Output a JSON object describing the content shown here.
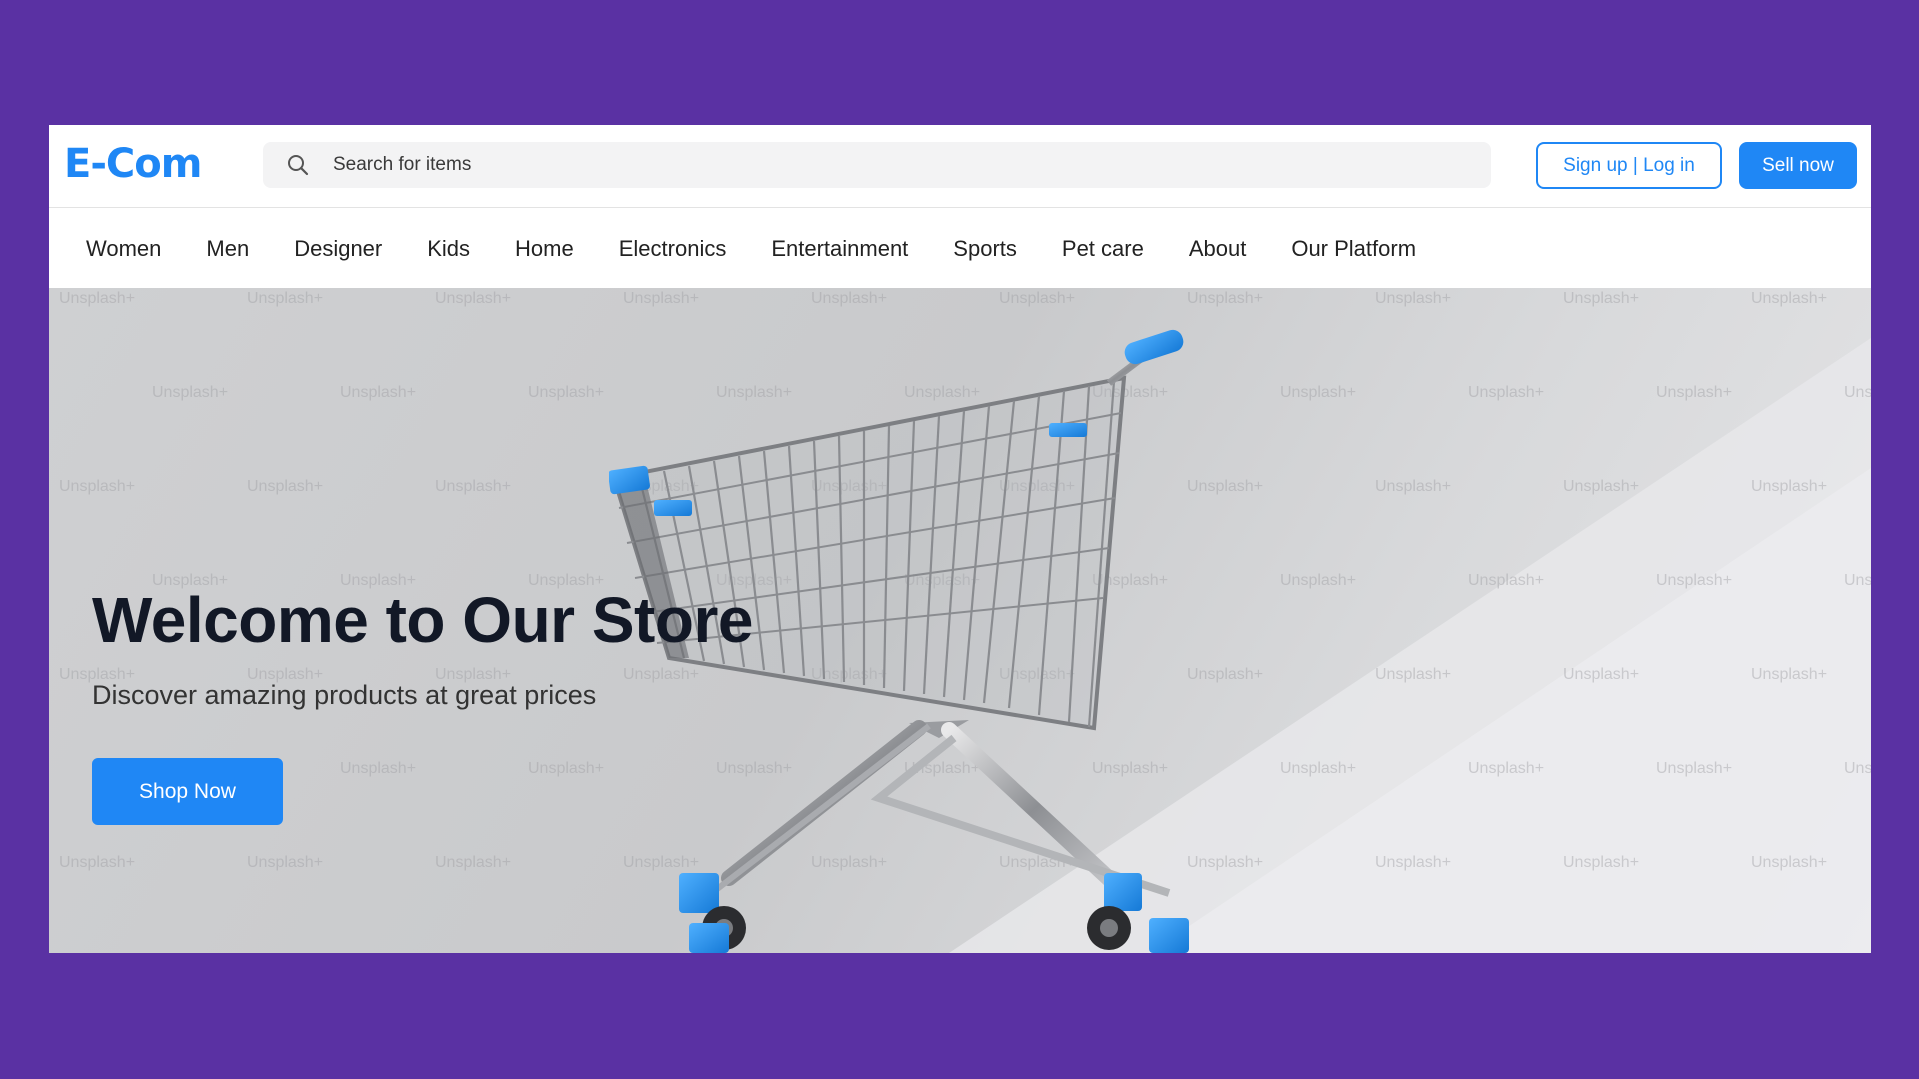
{
  "header": {
    "logo": "E-Com",
    "search": {
      "placeholder": "Search for items",
      "icon": "search-icon"
    },
    "auth_label": "Sign up | Log in",
    "sell_label": "Sell now"
  },
  "nav": {
    "items": [
      "Women",
      "Men",
      "Designer",
      "Kids",
      "Home",
      "Electronics",
      "Entertainment",
      "Sports",
      "Pet care",
      "About",
      "Our Platform"
    ]
  },
  "hero": {
    "title": "Welcome to Our Store",
    "subtitle": "Discover amazing products at great prices",
    "cta_label": "Shop Now",
    "watermark_text": "Unsplash+"
  },
  "colors": {
    "background": "#5a31a3",
    "accent": "#1f87f5",
    "title_text": "#121826"
  }
}
